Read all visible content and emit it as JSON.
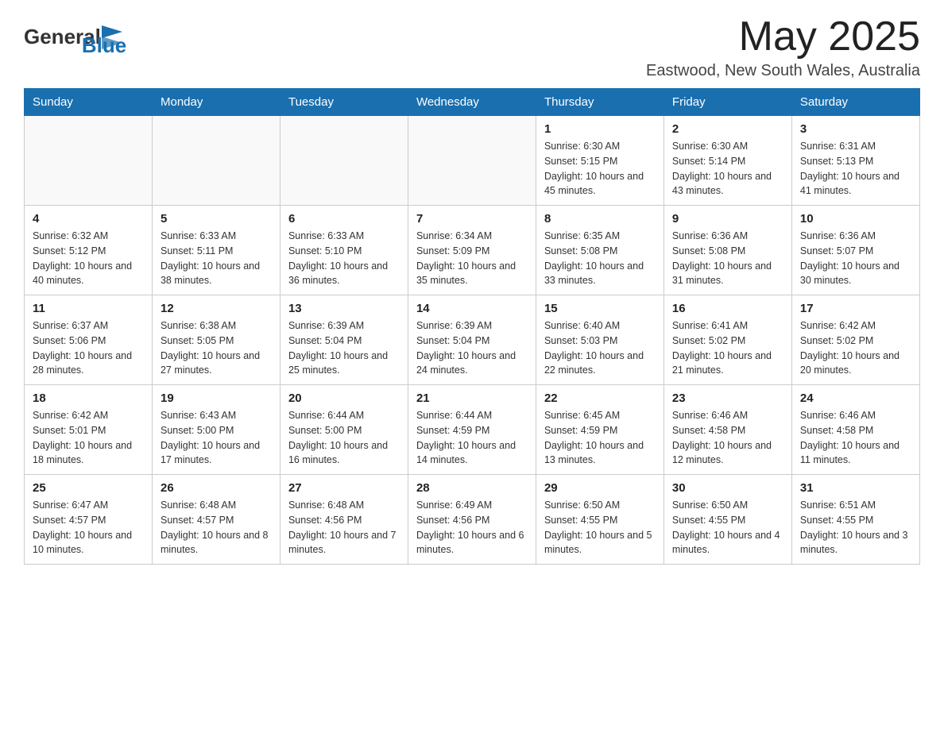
{
  "header": {
    "logo_general": "General",
    "logo_blue": "Blue",
    "month_title": "May 2025",
    "location": "Eastwood, New South Wales, Australia"
  },
  "weekdays": [
    "Sunday",
    "Monday",
    "Tuesday",
    "Wednesday",
    "Thursday",
    "Friday",
    "Saturday"
  ],
  "weeks": [
    [
      {
        "day": "",
        "info": ""
      },
      {
        "day": "",
        "info": ""
      },
      {
        "day": "",
        "info": ""
      },
      {
        "day": "",
        "info": ""
      },
      {
        "day": "1",
        "info": "Sunrise: 6:30 AM\nSunset: 5:15 PM\nDaylight: 10 hours and 45 minutes."
      },
      {
        "day": "2",
        "info": "Sunrise: 6:30 AM\nSunset: 5:14 PM\nDaylight: 10 hours and 43 minutes."
      },
      {
        "day": "3",
        "info": "Sunrise: 6:31 AM\nSunset: 5:13 PM\nDaylight: 10 hours and 41 minutes."
      }
    ],
    [
      {
        "day": "4",
        "info": "Sunrise: 6:32 AM\nSunset: 5:12 PM\nDaylight: 10 hours and 40 minutes."
      },
      {
        "day": "5",
        "info": "Sunrise: 6:33 AM\nSunset: 5:11 PM\nDaylight: 10 hours and 38 minutes."
      },
      {
        "day": "6",
        "info": "Sunrise: 6:33 AM\nSunset: 5:10 PM\nDaylight: 10 hours and 36 minutes."
      },
      {
        "day": "7",
        "info": "Sunrise: 6:34 AM\nSunset: 5:09 PM\nDaylight: 10 hours and 35 minutes."
      },
      {
        "day": "8",
        "info": "Sunrise: 6:35 AM\nSunset: 5:08 PM\nDaylight: 10 hours and 33 minutes."
      },
      {
        "day": "9",
        "info": "Sunrise: 6:36 AM\nSunset: 5:08 PM\nDaylight: 10 hours and 31 minutes."
      },
      {
        "day": "10",
        "info": "Sunrise: 6:36 AM\nSunset: 5:07 PM\nDaylight: 10 hours and 30 minutes."
      }
    ],
    [
      {
        "day": "11",
        "info": "Sunrise: 6:37 AM\nSunset: 5:06 PM\nDaylight: 10 hours and 28 minutes."
      },
      {
        "day": "12",
        "info": "Sunrise: 6:38 AM\nSunset: 5:05 PM\nDaylight: 10 hours and 27 minutes."
      },
      {
        "day": "13",
        "info": "Sunrise: 6:39 AM\nSunset: 5:04 PM\nDaylight: 10 hours and 25 minutes."
      },
      {
        "day": "14",
        "info": "Sunrise: 6:39 AM\nSunset: 5:04 PM\nDaylight: 10 hours and 24 minutes."
      },
      {
        "day": "15",
        "info": "Sunrise: 6:40 AM\nSunset: 5:03 PM\nDaylight: 10 hours and 22 minutes."
      },
      {
        "day": "16",
        "info": "Sunrise: 6:41 AM\nSunset: 5:02 PM\nDaylight: 10 hours and 21 minutes."
      },
      {
        "day": "17",
        "info": "Sunrise: 6:42 AM\nSunset: 5:02 PM\nDaylight: 10 hours and 20 minutes."
      }
    ],
    [
      {
        "day": "18",
        "info": "Sunrise: 6:42 AM\nSunset: 5:01 PM\nDaylight: 10 hours and 18 minutes."
      },
      {
        "day": "19",
        "info": "Sunrise: 6:43 AM\nSunset: 5:00 PM\nDaylight: 10 hours and 17 minutes."
      },
      {
        "day": "20",
        "info": "Sunrise: 6:44 AM\nSunset: 5:00 PM\nDaylight: 10 hours and 16 minutes."
      },
      {
        "day": "21",
        "info": "Sunrise: 6:44 AM\nSunset: 4:59 PM\nDaylight: 10 hours and 14 minutes."
      },
      {
        "day": "22",
        "info": "Sunrise: 6:45 AM\nSunset: 4:59 PM\nDaylight: 10 hours and 13 minutes."
      },
      {
        "day": "23",
        "info": "Sunrise: 6:46 AM\nSunset: 4:58 PM\nDaylight: 10 hours and 12 minutes."
      },
      {
        "day": "24",
        "info": "Sunrise: 6:46 AM\nSunset: 4:58 PM\nDaylight: 10 hours and 11 minutes."
      }
    ],
    [
      {
        "day": "25",
        "info": "Sunrise: 6:47 AM\nSunset: 4:57 PM\nDaylight: 10 hours and 10 minutes."
      },
      {
        "day": "26",
        "info": "Sunrise: 6:48 AM\nSunset: 4:57 PM\nDaylight: 10 hours and 8 minutes."
      },
      {
        "day": "27",
        "info": "Sunrise: 6:48 AM\nSunset: 4:56 PM\nDaylight: 10 hours and 7 minutes."
      },
      {
        "day": "28",
        "info": "Sunrise: 6:49 AM\nSunset: 4:56 PM\nDaylight: 10 hours and 6 minutes."
      },
      {
        "day": "29",
        "info": "Sunrise: 6:50 AM\nSunset: 4:55 PM\nDaylight: 10 hours and 5 minutes."
      },
      {
        "day": "30",
        "info": "Sunrise: 6:50 AM\nSunset: 4:55 PM\nDaylight: 10 hours and 4 minutes."
      },
      {
        "day": "31",
        "info": "Sunrise: 6:51 AM\nSunset: 4:55 PM\nDaylight: 10 hours and 3 minutes."
      }
    ]
  ]
}
